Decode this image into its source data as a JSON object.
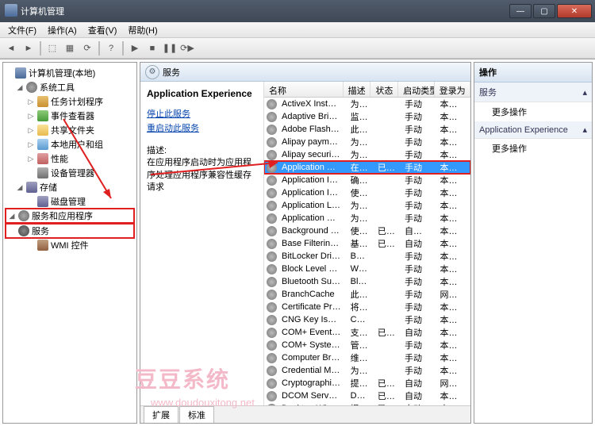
{
  "window": {
    "title": "计算机管理"
  },
  "menu": {
    "file": "文件(F)",
    "action": "操作(A)",
    "view": "查看(V)",
    "help": "帮助(H)"
  },
  "tree": {
    "root": "计算机管理(本地)",
    "systools": "系统工具",
    "tasksched": "任务计划程序",
    "eventview": "事件查看器",
    "sharedfolders": "共享文件夹",
    "localusers": "本地用户和组",
    "performance": "性能",
    "devicemgr": "设备管理器",
    "storage": "存储",
    "diskmgmt": "磁盘管理",
    "servicesapps": "服务和应用程序",
    "services": "服务",
    "wmi": "WMI 控件"
  },
  "center": {
    "header": "服务",
    "detail_title": "Application Experience",
    "stop_link": "停止此服务",
    "restart_link": "重启动此服务",
    "desc_label": "描述:",
    "desc_text": "在应用程序启动时为应用程序处理应用程序兼容性缓存请求",
    "tab_extended": "扩展",
    "tab_standard": "标准"
  },
  "columns": {
    "name": "名称",
    "desc": "描述",
    "status": "状态",
    "startup": "启动类型",
    "logon": "登录为"
  },
  "services": [
    {
      "n": "ActiveX Installer ...",
      "d": "为从...",
      "s": "",
      "t": "手动",
      "l": "本地系统"
    },
    {
      "n": "Adaptive Brightn...",
      "d": "监视...",
      "s": "",
      "t": "手动",
      "l": "本地服务"
    },
    {
      "n": "Adobe Flash Pla...",
      "d": "此服...",
      "s": "",
      "t": "手动",
      "l": "本地系统"
    },
    {
      "n": "Alipay payment ...",
      "d": "为支...",
      "s": "",
      "t": "手动",
      "l": "本地系统"
    },
    {
      "n": "Alipay security b...",
      "d": "为支...",
      "s": "",
      "t": "手动",
      "l": "本地系统"
    },
    {
      "n": "Application Expe...",
      "d": "在应...",
      "s": "已启动",
      "t": "手动",
      "l": "本地系统",
      "sel": true
    },
    {
      "n": "Application Iden...",
      "d": "确定...",
      "s": "",
      "t": "手动",
      "l": "本地服务"
    },
    {
      "n": "Application Info...",
      "d": "使用...",
      "s": "",
      "t": "手动",
      "l": "本地系统"
    },
    {
      "n": "Application Laye...",
      "d": "为 In...",
      "s": "",
      "t": "手动",
      "l": "本地服务"
    },
    {
      "n": "Application Man...",
      "d": "为通...",
      "s": "",
      "t": "手动",
      "l": "本地系统"
    },
    {
      "n": "Background Inte...",
      "d": "使用...",
      "s": "已启动",
      "t": "自动(延迟...",
      "l": "本地系统"
    },
    {
      "n": "Base Filtering En...",
      "d": "基本...",
      "s": "已启动",
      "t": "自动",
      "l": "本地服务"
    },
    {
      "n": "BitLocker Drive ...",
      "d": "BDE...",
      "s": "",
      "t": "手动",
      "l": "本地系统"
    },
    {
      "n": "Block Level Back...",
      "d": "Win...",
      "s": "",
      "t": "手动",
      "l": "本地系统"
    },
    {
      "n": "Bluetooth Supp...",
      "d": "Blu...",
      "s": "",
      "t": "手动",
      "l": "本地服务"
    },
    {
      "n": "BranchCache",
      "d": "此服...",
      "s": "",
      "t": "手动",
      "l": "网络服务"
    },
    {
      "n": "Certificate Propa...",
      "d": "将用...",
      "s": "",
      "t": "手动",
      "l": "本地系统"
    },
    {
      "n": "CNG Key Isolation",
      "d": "CNG...",
      "s": "",
      "t": "手动",
      "l": "本地系统"
    },
    {
      "n": "COM+ Event Sys...",
      "d": "支持...",
      "s": "已启动",
      "t": "自动",
      "l": "本地服务"
    },
    {
      "n": "COM+ System A...",
      "d": "管理...",
      "s": "",
      "t": "手动",
      "l": "本地系统"
    },
    {
      "n": "Computer Brow...",
      "d": "维护...",
      "s": "",
      "t": "手动",
      "l": "本地系统"
    },
    {
      "n": "Credential Mana...",
      "d": "为用...",
      "s": "",
      "t": "手动",
      "l": "本地系统"
    },
    {
      "n": "Cryptographic S...",
      "d": "提供...",
      "s": "已启动",
      "t": "自动",
      "l": "网络服务"
    },
    {
      "n": "DCOM Server Pr...",
      "d": "DCO...",
      "s": "已启动",
      "t": "自动",
      "l": "本地系统"
    },
    {
      "n": "Desktop Windo...",
      "d": "提供...",
      "s": "已启动",
      "t": "自动",
      "l": "本地系统"
    }
  ],
  "actions": {
    "header": "操作",
    "section1": "服务",
    "more": "更多操作",
    "section2": "Application Experience"
  },
  "watermark": {
    "text": "豆豆系统",
    "url": "www.doudouxitong.net"
  }
}
